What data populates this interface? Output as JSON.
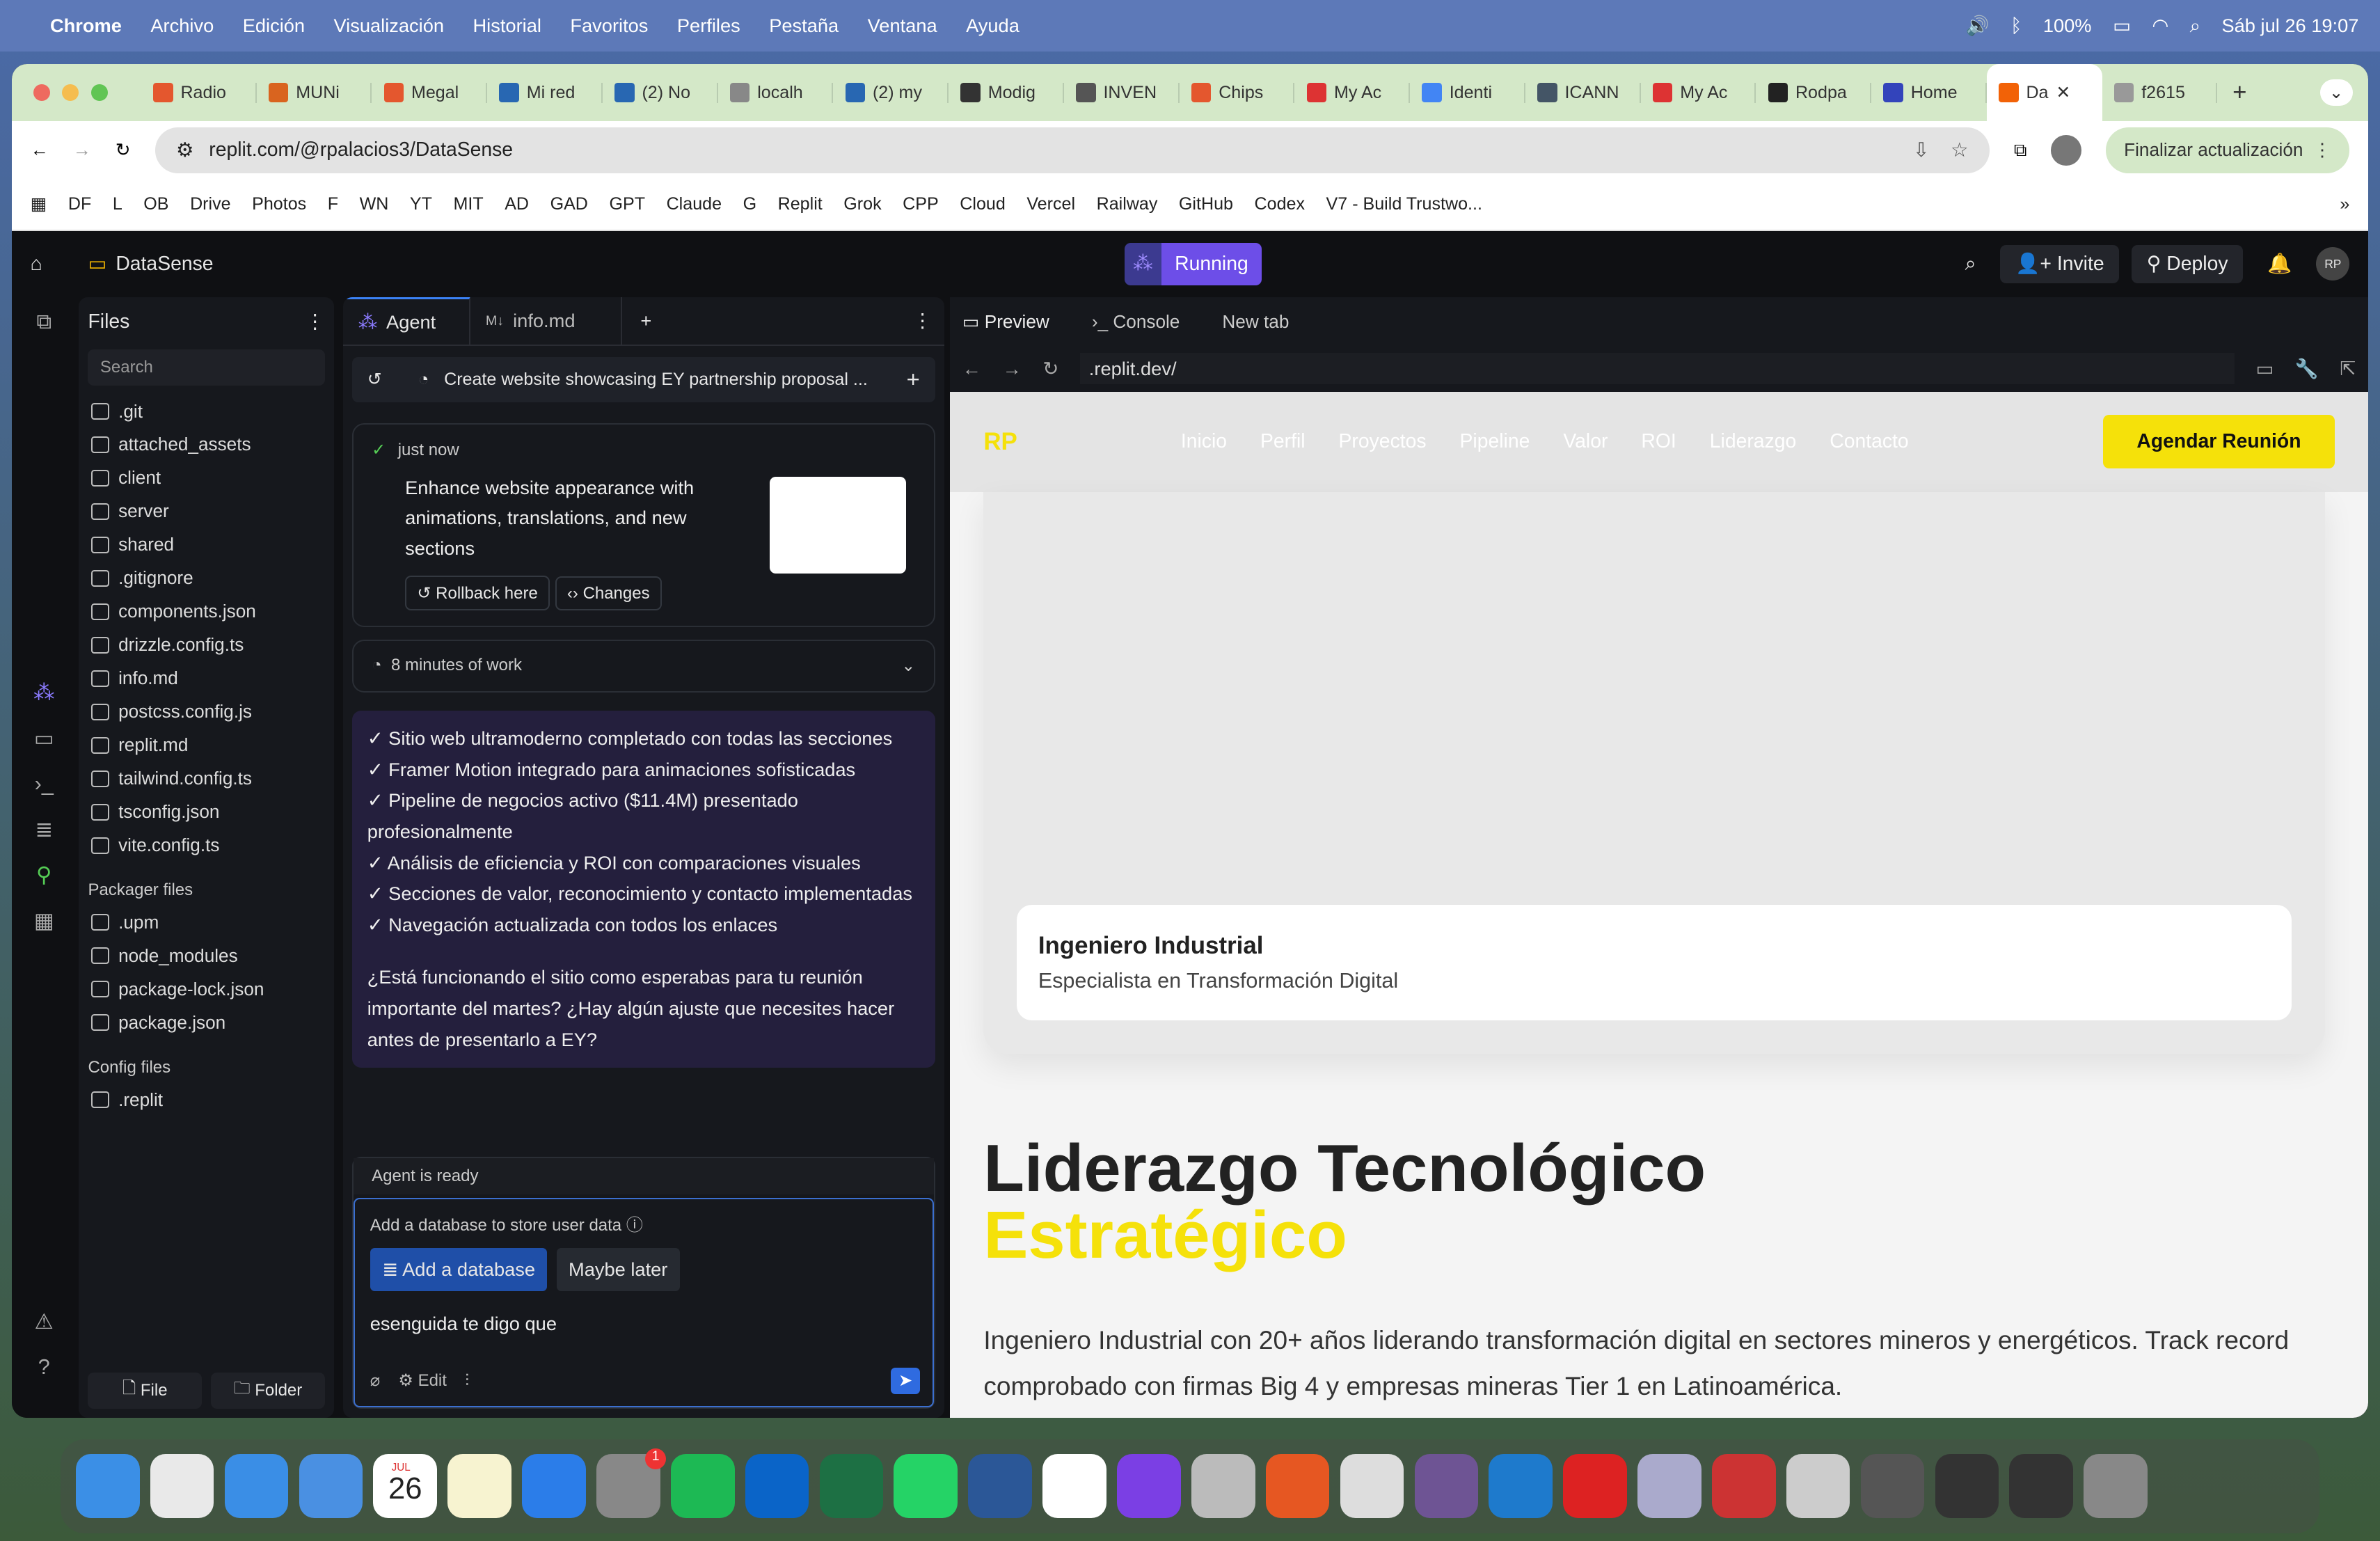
{
  "menubar": {
    "app": "Chrome",
    "items": [
      "Archivo",
      "Edición",
      "Visualización",
      "Historial",
      "Favoritos",
      "Perfiles",
      "Pestaña",
      "Ventana",
      "Ayuda"
    ],
    "battery": "100%",
    "datetime": "Sáb jul 26  19:07"
  },
  "browser": {
    "tabs": [
      "Radio",
      "MUNi",
      "Megal",
      "Mi red",
      "(2) No",
      "localh",
      "(2) my",
      "Modig",
      "INVEN",
      "Chips",
      "My Ac",
      "Identi",
      "ICANN",
      "My Ac",
      "Rodpa",
      "Home",
      "Da",
      "f2615"
    ],
    "url": "replit.com/@rpalacios3/DataSense",
    "update_button": "Finalizar actualización",
    "bookmarks": [
      "DF",
      "L",
      "OB",
      "Drive",
      "Photos",
      "F",
      "WN",
      "YT",
      "MIT",
      "AD",
      "GAD",
      "GPT",
      "Claude",
      "G",
      "Replit",
      "Grok",
      "CPP",
      "Cloud",
      "Vercel",
      "Railway",
      "GitHub",
      "Codex",
      "V7 - Build Trustwo..."
    ]
  },
  "replit": {
    "project": "DataSense",
    "status": "Running",
    "invite": "Invite",
    "deploy": "Deploy",
    "avatar": "RP",
    "files": {
      "title": "Files",
      "search": "Search",
      "items": [
        ".git",
        "attached_assets",
        "client",
        "server",
        "shared",
        ".gitignore",
        "components.json",
        "drizzle.config.ts",
        "info.md",
        "postcss.config.js",
        "replit.md",
        "tailwind.config.ts",
        "tsconfig.json",
        "vite.config.ts"
      ],
      "packager_title": "Packager files",
      "packager": [
        ".upm",
        "node_modules",
        "package-lock.json",
        "package.json"
      ],
      "config_title": "Config files",
      "config": [
        ".replit"
      ],
      "new_file": "File",
      "new_folder": "Folder"
    },
    "agent": {
      "tab": "Agent",
      "tab2": "info.md",
      "thread_title": "Create website showcasing EY partnership proposal ...",
      "checkpoint_time": "just now",
      "checkpoint_text": "Enhance website appearance with animations, translations, and new sections",
      "rollback": "Rollback here",
      "changes": "Changes",
      "work": "8 minutes of work",
      "message": [
        "✓ Sitio web ultramoderno completado con todas las secciones",
        "✓ Framer Motion integrado para animaciones sofisticadas",
        "✓ Pipeline de negocios activo ($11.4M) presentado profesionalmente",
        "✓ Análisis de eficiencia y ROI con comparaciones visuales",
        "✓ Secciones de valor, reconocimiento y contacto implementadas",
        "✓ Navegación actualizada con todos los enlaces"
      ],
      "question": "¿Está funcionando el sitio como esperabas para tu reunión importante del martes? ¿Hay algún ajuste que necesites hacer antes de presentarlo a EY?",
      "ready": "Agent is ready",
      "db_prompt": "Add a database to store user data",
      "add_db": "Add a database",
      "maybe": "Maybe later",
      "input": "esenguida te digo que",
      "edit": "Edit"
    },
    "preview": {
      "tab": "Preview",
      "console": "Console",
      "newtab": "New tab",
      "url": ".replit.dev/",
      "site": {
        "logo": "RP",
        "nav": [
          "Inicio",
          "Perfil",
          "Proyectos",
          "Pipeline",
          "Valor",
          "ROI",
          "Liderazgo",
          "Contacto"
        ],
        "cta": "Agendar Reunión",
        "card_title": "Ingeniero Industrial",
        "card_sub": "Especialista en Transformación Digital",
        "h1a": "Liderazgo Tecnológico",
        "h1b": "Estratégico",
        "lead": "Ingeniero Industrial con 20+ años liderando transformación digital en sectores mineros y energéticos. Track record comprobado con firmas Big 4 y empresas mineras Tier 1 en Latinoamérica."
      }
    }
  },
  "dock": {
    "calendar_month": "JUL",
    "calendar_day": "26",
    "badge": "1"
  }
}
